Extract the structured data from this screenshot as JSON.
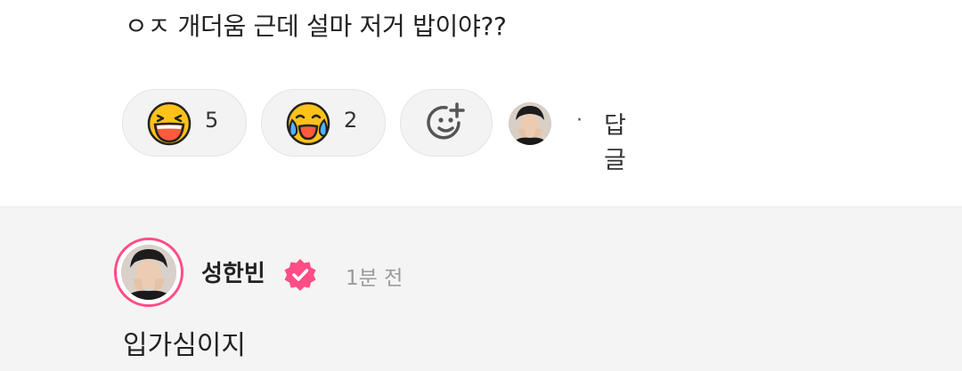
{
  "comment": {
    "text": "ㅇㅈ 개더움 근데 설마 저거 밥이야??"
  },
  "reactions": [
    {
      "icon": "laughing-emoji-icon",
      "count": "5"
    },
    {
      "icon": "crying-laughing-emoji-icon",
      "count": "2"
    }
  ],
  "add_reaction_icon": "add-reaction-icon",
  "separator": "·",
  "reply_label": "답글",
  "reply": {
    "author": "성한빈",
    "time": "1분 전",
    "text": "입가심이지"
  },
  "colors": {
    "accent": "#ff4d86",
    "pill_bg": "#f3f3f3",
    "section_bg": "#f4f4f4"
  }
}
